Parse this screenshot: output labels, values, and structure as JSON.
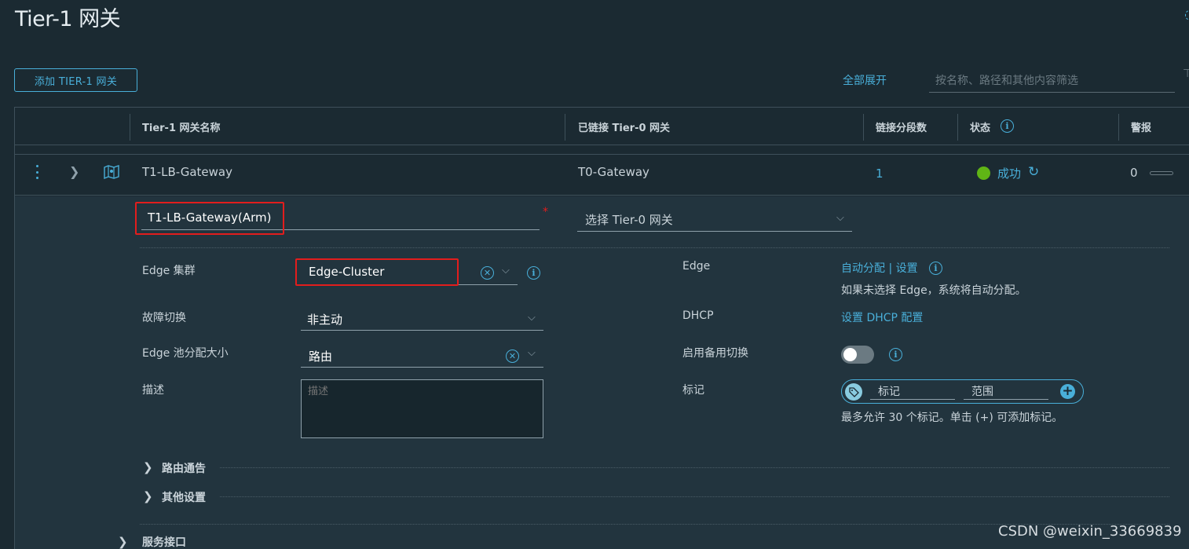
{
  "page": {
    "title": "Tier-1 网关",
    "add_button": "添加 TIER-1 网关",
    "expand_all": "全部展开",
    "filter_placeholder": "按名称、路径和其他内容筛选"
  },
  "table": {
    "headers": {
      "name": "Tier-1 网关名称",
      "linked_t0": "已链接 Tier-0 网关",
      "segments": "链接分段数",
      "status": "状态",
      "alarms": "警报"
    },
    "row": {
      "name": "T1-LB-Gateway",
      "linked_t0": "T0-Gateway",
      "segments": "1",
      "status": "成功",
      "alarms": "0"
    }
  },
  "edit": {
    "name_value": "T1-LB-Gateway(Arm)",
    "required_mark": "*",
    "t0_placeholder": "选择 Tier-0 网关",
    "edge_cluster_label": "Edge 集群",
    "edge_cluster_value": "Edge-Cluster",
    "failover_label": "故障切换",
    "failover_value": "非主动",
    "pool_size_label": "Edge 池分配大小",
    "pool_size_value": "路由",
    "description_label": "描述",
    "description_placeholder": "描述",
    "edge_label": "Edge",
    "edge_link": "自动分配 | 设置",
    "edge_hint": "如果未选择 Edge，系统将自动分配。",
    "dhcp_label": "DHCP",
    "dhcp_link": "设置 DHCP 配置",
    "standby_label": "启用备用切换",
    "tags_label": "标记",
    "tag_placeholder": "标记",
    "scope_placeholder": "范围",
    "tags_hint": "最多允许 30 个标记。单击 (+) 可添加标记。",
    "section_route_adv": "路由通告",
    "section_other": "其他设置",
    "section_service_if": "服务接口"
  },
  "colors": {
    "background": "#1b2a32",
    "panel": "#22343e",
    "accent": "#49afd9",
    "highlight_box": "#e21d1d",
    "status_success": "#60b515"
  },
  "watermark": "CSDN @weixin_33669839"
}
